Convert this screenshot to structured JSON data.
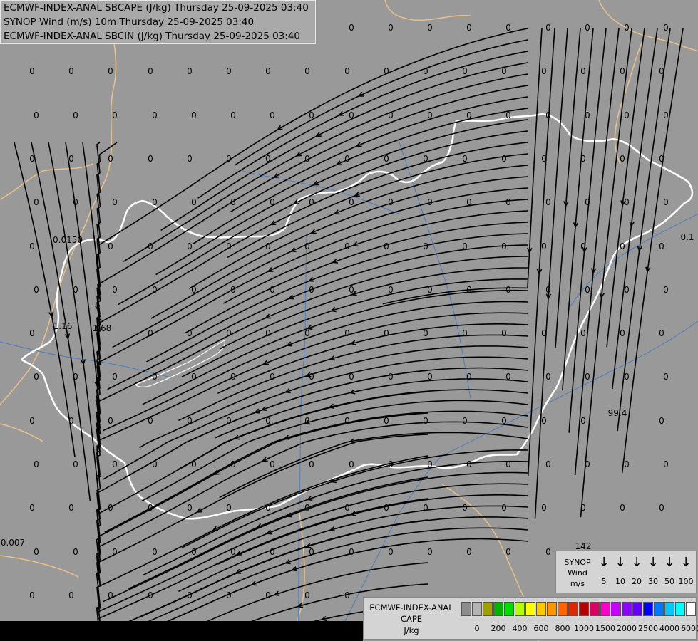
{
  "header": {
    "line1": "ECMWF-INDEX-ANAL SBCAPE (J/kg) Thursday 25-09-2025 03:40",
    "line2": "SYNOP Wind (m/s) 10m Thursday 25-09-2025 03:40",
    "line3": "ECMWF-INDEX-ANAL SBCIN (J/kg) Thursday 25-09-2025 03:40"
  },
  "wind_legend": {
    "title_1": "SYNOP",
    "title_2": "Wind",
    "title_3": "m/s",
    "arrow_glyph": "↓",
    "values": [
      "5",
      "10",
      "20",
      "30",
      "50",
      "100"
    ]
  },
  "cape_legend": {
    "title_1": "ECMWF-INDEX-ANAL",
    "title_2": "CAPE",
    "title_3": "J/kg",
    "colors": [
      "#8c8c8c",
      "#b4b4b4",
      "#a0a000",
      "#00b400",
      "#00dc00",
      "#b4ff00",
      "#ffff00",
      "#ffc800",
      "#ff9600",
      "#ff6400",
      "#dc2800",
      "#b40000",
      "#dc0064",
      "#ff00c8",
      "#c800ff",
      "#8c00ff",
      "#6400ff",
      "#0000ff",
      "#0078ff",
      "#00c8ff",
      "#00ffff",
      "#ffffff"
    ],
    "ticks": [
      "0",
      "200",
      "400",
      "600",
      "800",
      "1000",
      "1500",
      "2000",
      "2500",
      "4000",
      "6000"
    ]
  },
  "map_values": {
    "zero": "0",
    "special": [
      "0.0150",
      "1.16",
      "1.68",
      "0.007",
      "99.4",
      "142",
      "0.1"
    ]
  },
  "colors": {
    "background": "#999999",
    "border": "#ffffff",
    "river": "#4a7dbd",
    "outer_border": "#e8c28a",
    "stream": "#000000"
  }
}
